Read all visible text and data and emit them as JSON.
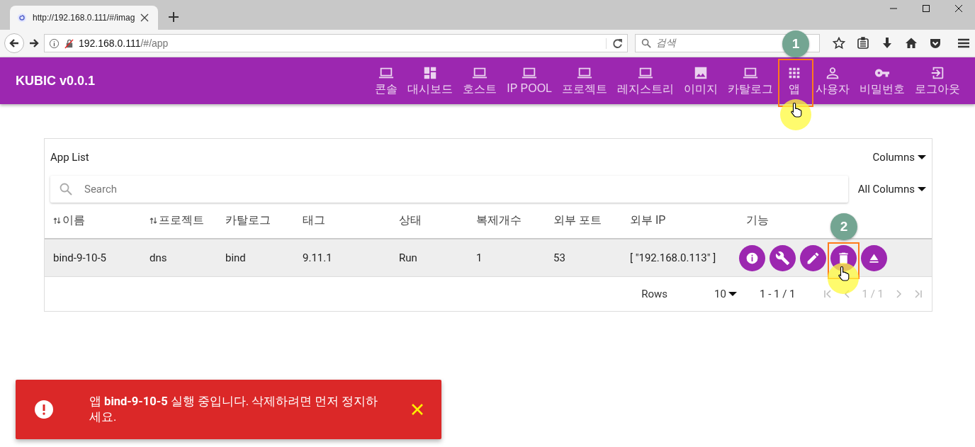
{
  "browser": {
    "tab_title": "http://192.168.0.111/#/imag",
    "url_host": "192.168.0.111",
    "url_path": "/#/app",
    "search_placeholder": "검색"
  },
  "app_bar": {
    "title": "KUBIC v0.0.1",
    "nav": [
      {
        "label": "콘솔",
        "kind": "laptop"
      },
      {
        "label": "대시보드",
        "kind": "dashboard"
      },
      {
        "label": "호스트",
        "kind": "laptop"
      },
      {
        "label": "IP POOL",
        "kind": "laptop"
      },
      {
        "label": "프로젝트",
        "kind": "laptop"
      },
      {
        "label": "레지스트리",
        "kind": "laptop"
      },
      {
        "label": "이미지",
        "kind": "image"
      },
      {
        "label": "카탈로그",
        "kind": "laptop"
      },
      {
        "label": "앱",
        "kind": "apps",
        "annotation": "1"
      },
      {
        "label": "사용자",
        "kind": "person"
      },
      {
        "label": "비밀번호",
        "kind": "key"
      },
      {
        "label": "로그아웃",
        "kind": "logout"
      }
    ]
  },
  "app_list": {
    "title": "App List",
    "columns_menu": "Columns",
    "search_placeholder": "Search",
    "filter_menu": "All Columns",
    "columns": [
      {
        "label": "이름",
        "sortable": true
      },
      {
        "label": "프로젝트",
        "sortable": true
      },
      {
        "label": "카탈로그",
        "sortable": false
      },
      {
        "label": "태그",
        "sortable": false
      },
      {
        "label": "상태",
        "sortable": false
      },
      {
        "label": "복제개수",
        "sortable": false
      },
      {
        "label": "외부 포트",
        "sortable": false
      },
      {
        "label": "외부 IP",
        "sortable": false
      },
      {
        "label": "기능",
        "sortable": false
      }
    ],
    "rows": [
      {
        "cells": [
          "bind-9-10-5",
          "dns",
          "bind",
          "9.11.1",
          "Run",
          "1",
          "53",
          "[ \"192.168.0.113\" ]"
        ],
        "actions": [
          {
            "kind": "info"
          },
          {
            "kind": "wrench"
          },
          {
            "kind": "edit"
          },
          {
            "kind": "delete",
            "annotation": "2"
          },
          {
            "kind": "eject"
          }
        ]
      }
    ],
    "footer": {
      "rows_label": "Rows",
      "rows_per_page": "10",
      "range": "1 - 1 / 1",
      "page": "1 / 1"
    }
  },
  "snackbar": {
    "message": "앱 **bind-9-10-5** 실행 중입니다. 삭제하려면 먼저 정지하세요."
  }
}
